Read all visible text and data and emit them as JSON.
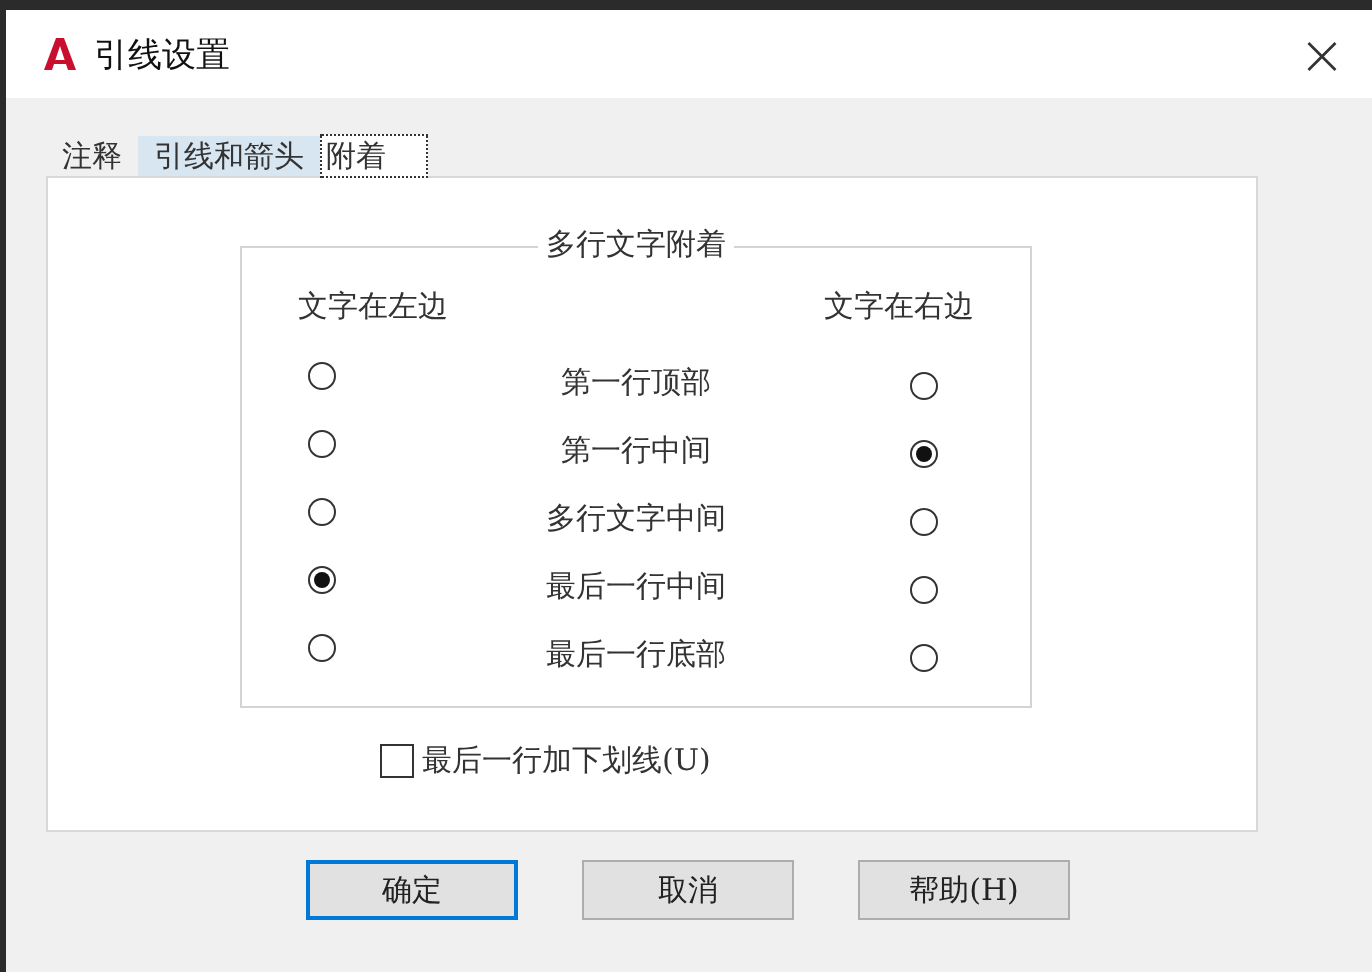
{
  "window": {
    "title": "引线设置",
    "close": "×"
  },
  "tabs": [
    {
      "label": "注释",
      "selected": false,
      "hover": false
    },
    {
      "label": "引线和箭头",
      "selected": false,
      "hover": true
    },
    {
      "label": "附着",
      "selected": true,
      "hover": false
    }
  ],
  "group": {
    "title": "多行文字附着",
    "left_heading": "文字在左边",
    "right_heading": "文字在右边",
    "rows": [
      {
        "label": "第一行顶部",
        "left_selected": false,
        "right_selected": false
      },
      {
        "label": "第一行中间",
        "left_selected": false,
        "right_selected": true
      },
      {
        "label": "多行文字中间",
        "left_selected": false,
        "right_selected": false
      },
      {
        "label": "最后一行中间",
        "left_selected": true,
        "right_selected": false
      },
      {
        "label": "最后一行底部",
        "left_selected": false,
        "right_selected": false
      }
    ]
  },
  "underline_option": {
    "label": "最后一行加下划线(U)",
    "checked": false
  },
  "buttons": [
    {
      "label": "确定",
      "default": true
    },
    {
      "label": "取消",
      "default": false
    },
    {
      "label": "帮助(H)",
      "default": false
    }
  ]
}
